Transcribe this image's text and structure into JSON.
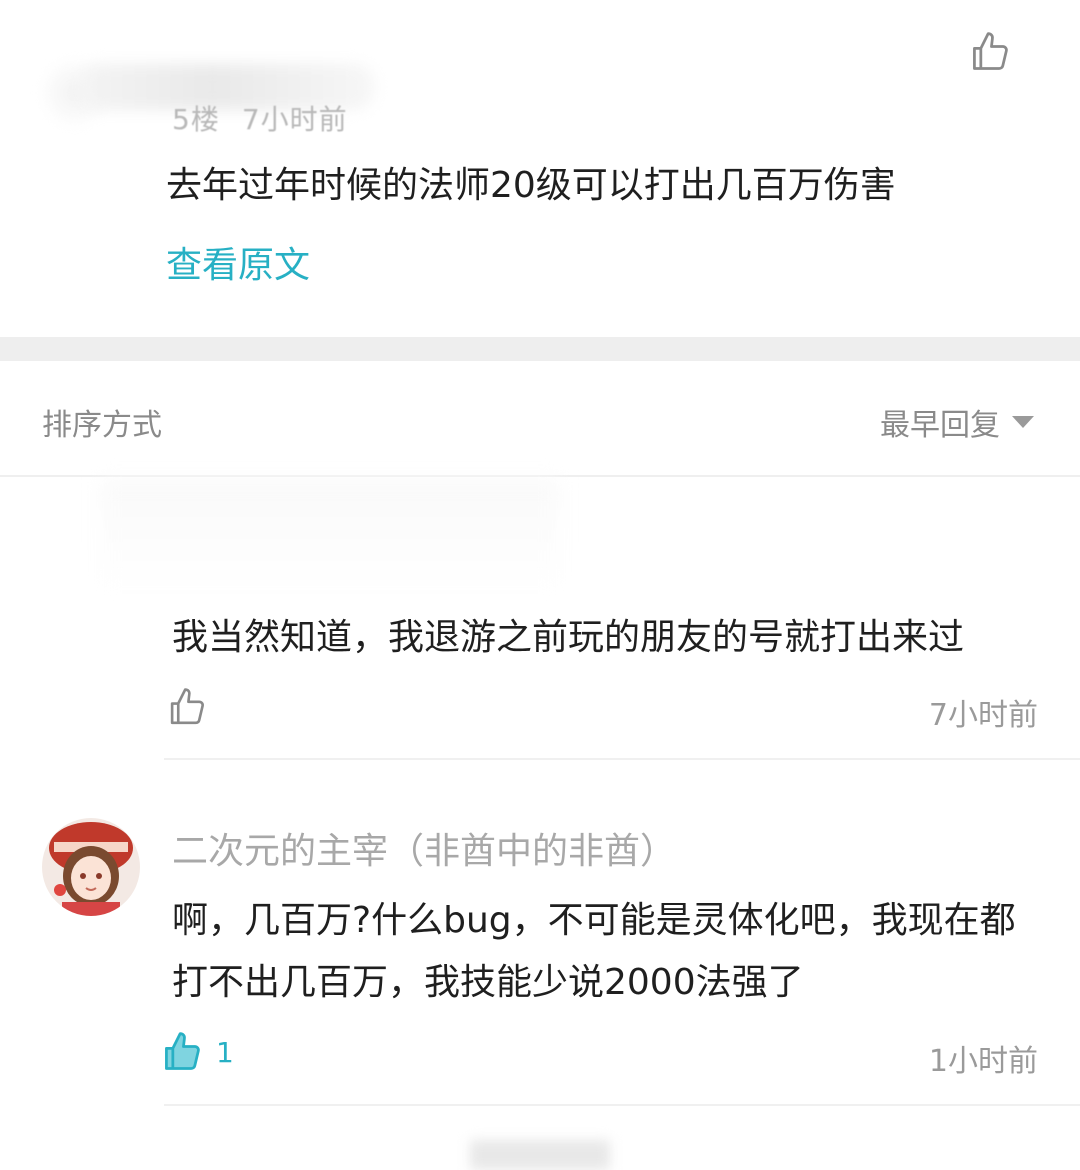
{
  "floor_comment": {
    "floor": "5楼",
    "time": "7小时前",
    "text": "去年过年时候的法师20级可以打出几百万伤害",
    "view_original": "查看原文"
  },
  "sort_bar": {
    "label": "排序方式",
    "value": "最早回复"
  },
  "replies": [
    {
      "text": "我当然知道，我退游之前玩的朋友的号就打出来过",
      "time": "7小时前",
      "likes": ""
    },
    {
      "author": "二次元的主宰（非酋中的非酋）",
      "text": "啊，几百万?什么bug，不可能是灵体化吧，我现在都打不出几百万，我技能少说2000法强了",
      "time": "1小时前",
      "likes": "1"
    }
  ],
  "colors": {
    "accent": "#27b0c4",
    "text": "#1f1f1f",
    "muted": "#9a9a9a",
    "gap": "#eeeeee"
  },
  "icons": [
    "thumbs-up-icon",
    "thumbs-up-filled-icon",
    "caret-down-icon"
  ]
}
